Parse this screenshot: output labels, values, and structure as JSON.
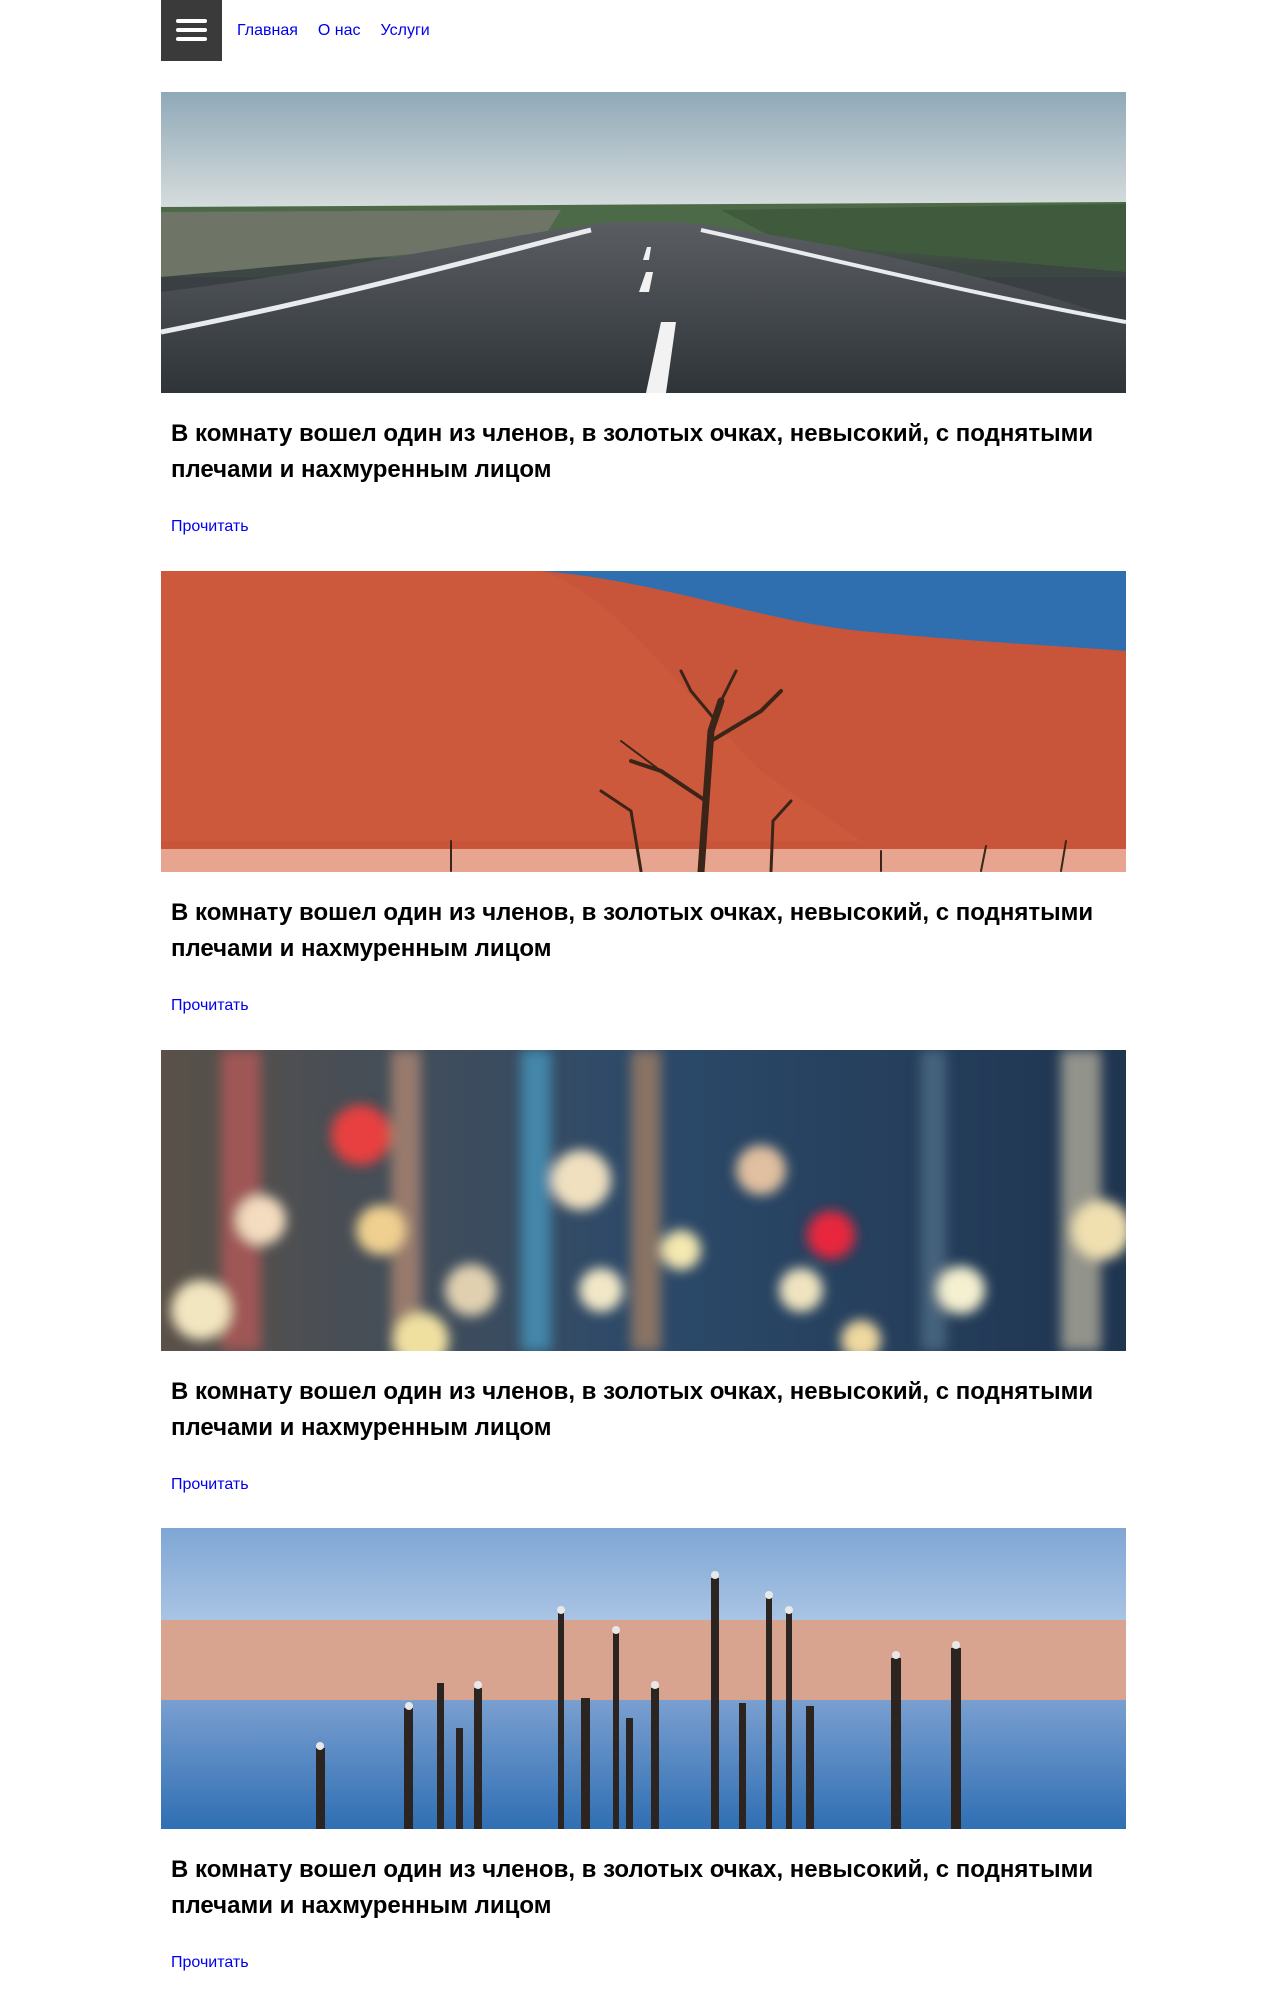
{
  "nav": {
    "menu_icon": "hamburger-menu-icon",
    "links": [
      "Главная",
      "О нас",
      "Услуги"
    ]
  },
  "posts": [
    {
      "image": "road-landscape-photo",
      "title": "В комнату вошел один из членов, в золотых очках, невысокий, с поднятыми плечами и нахмуренным лицом",
      "link": "Прочитать"
    },
    {
      "image": "red-desert-dune-photo",
      "title": "В комнату вошел один из членов, в золотых очках, невысокий, с поднятыми плечами и нахмуренным лицом",
      "link": "Прочитать"
    },
    {
      "image": "city-bokeh-lights-photo",
      "title": "В комнату вошел один из членов, в золотых очках, невысокий, с поднятыми плечами и нахмуренным лицом",
      "link": "Прочитать"
    },
    {
      "image": "sea-posts-birds-photo",
      "title": "В комнату вошел один из членов, в золотых очках, невысокий, с поднятыми плечами и нахмуренным лицом",
      "link": "Прочитать"
    }
  ],
  "colors": {
    "link": "#0000ee",
    "burger_bg": "#3a3a3a"
  }
}
